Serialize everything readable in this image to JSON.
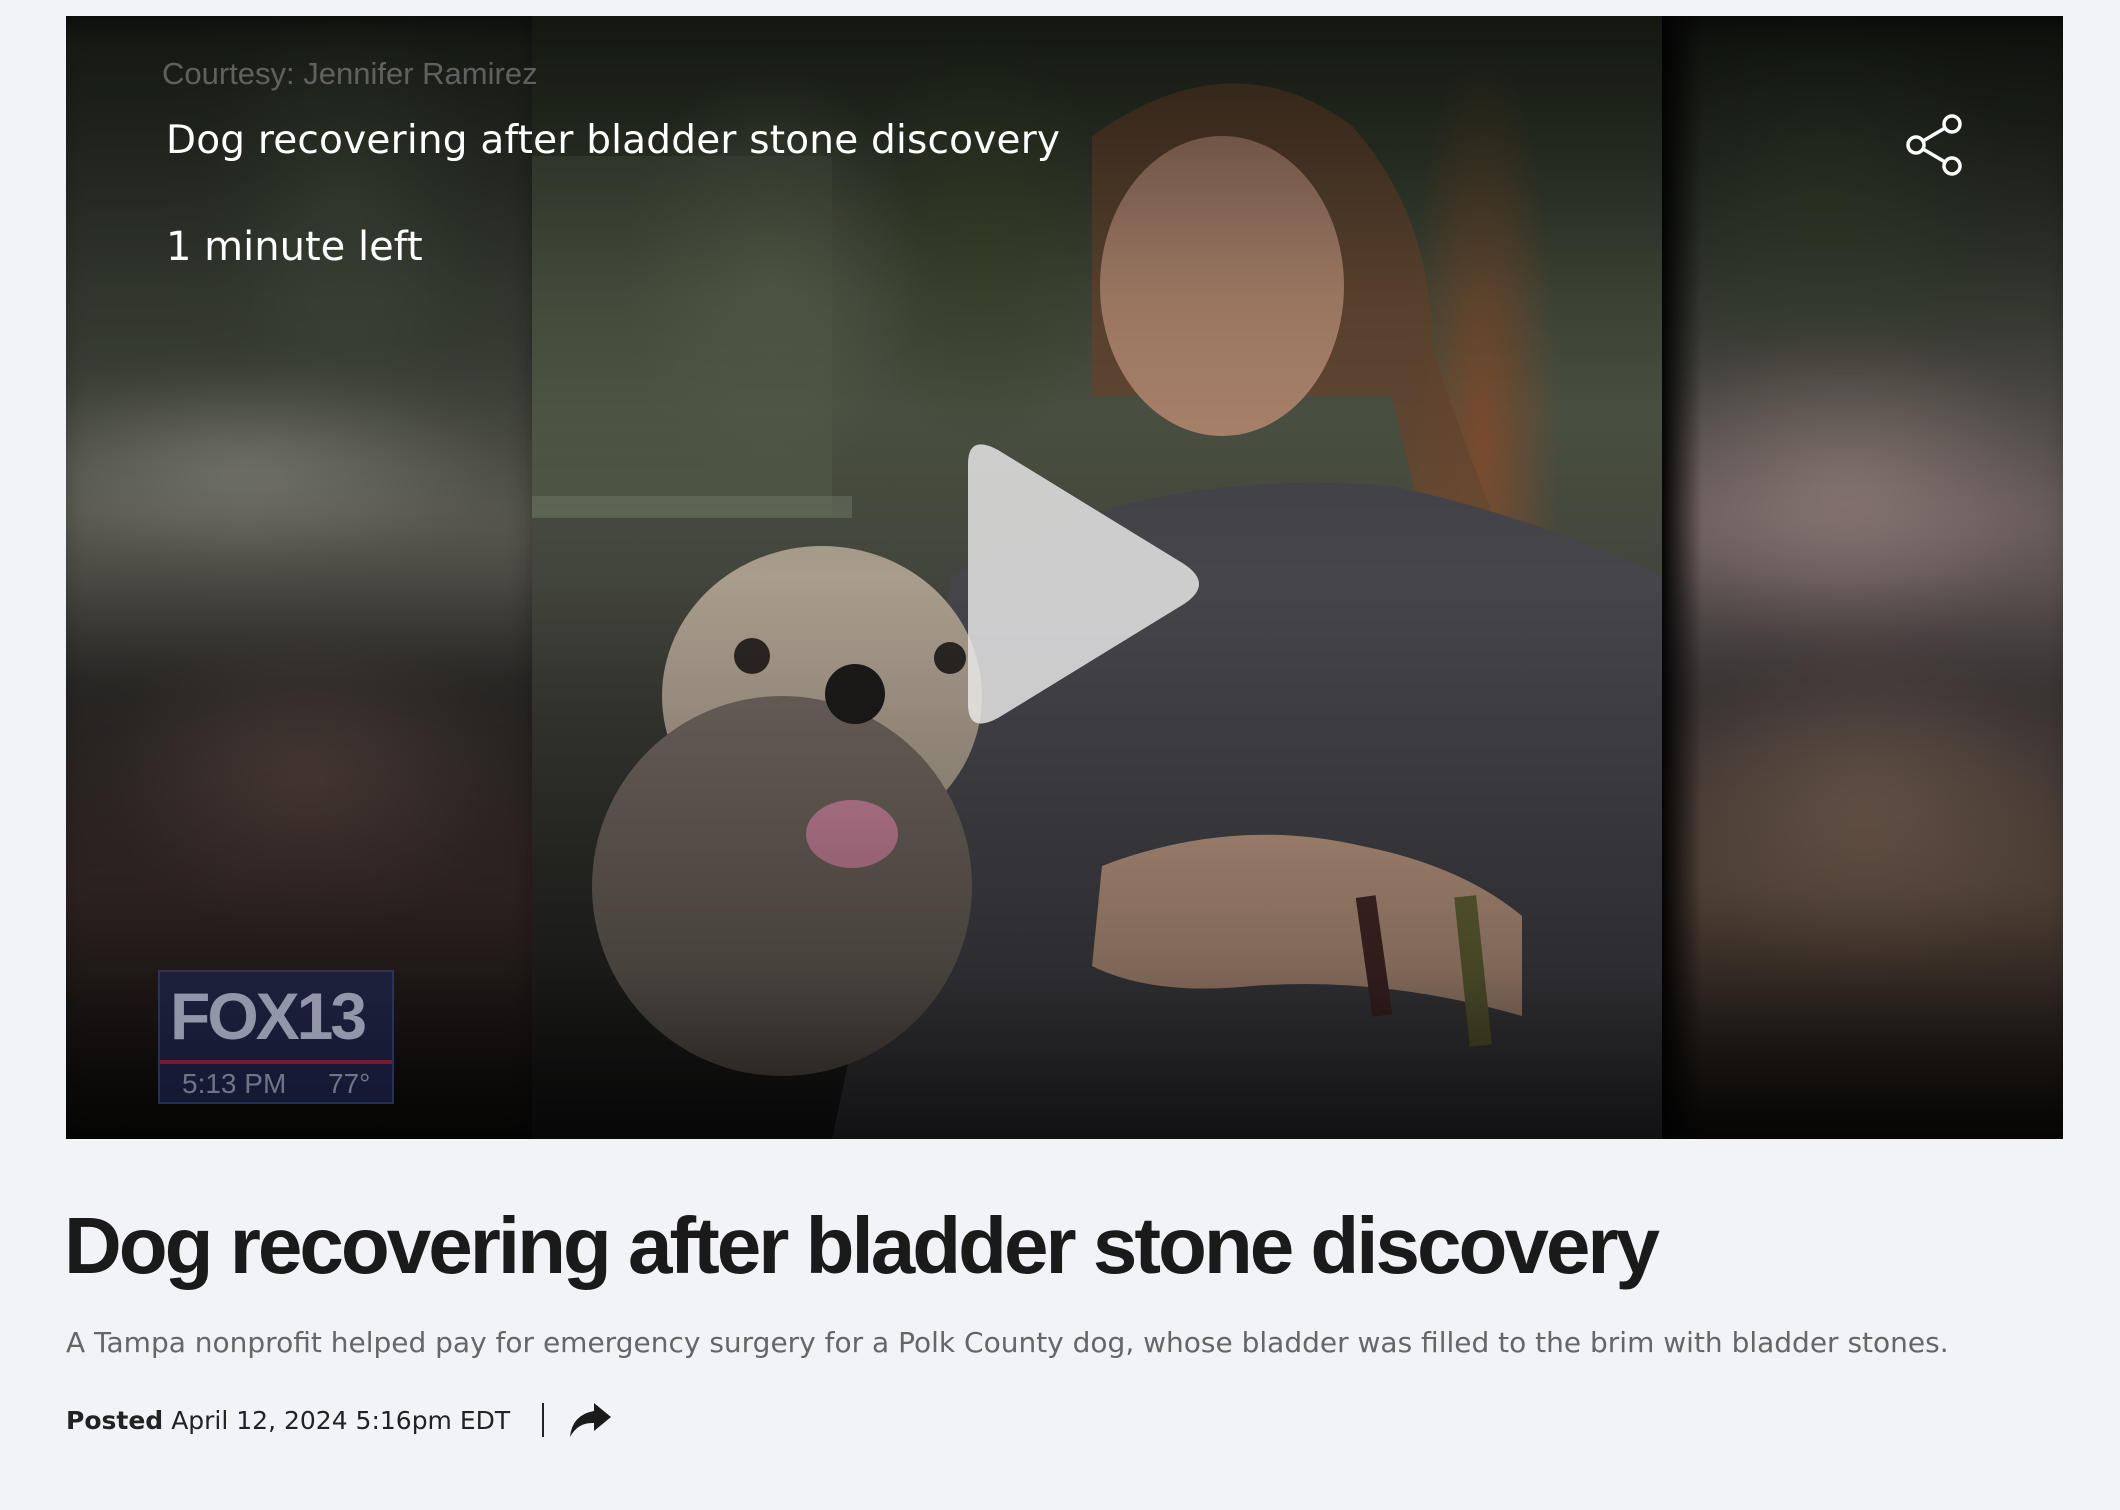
{
  "video": {
    "credit": "Courtesy: Jennifer Ramirez",
    "title": "Dog recovering after bladder stone discovery",
    "time_left": "1 minute left",
    "share_icon": "share-nodes-icon",
    "play_icon": "play-icon",
    "station_logo": {
      "name": "FOX13",
      "time": "5:13 PM",
      "temperature": "77°"
    }
  },
  "article": {
    "headline": "Dog recovering after bladder stone discovery",
    "summary": "A Tampa nonprofit helped pay for emergency surgery for a Polk County dog, whose bladder was filled to the brim with bladder stones.",
    "posted_label": "Posted",
    "posted_date": "April 12, 2024 5:16pm EDT",
    "share_icon": "share-arrow-icon"
  },
  "colors": {
    "page_background": "#f2f3f6",
    "headline": "#1a1a1a",
    "summary": "#666666",
    "overlay_text": "#ffffff"
  }
}
